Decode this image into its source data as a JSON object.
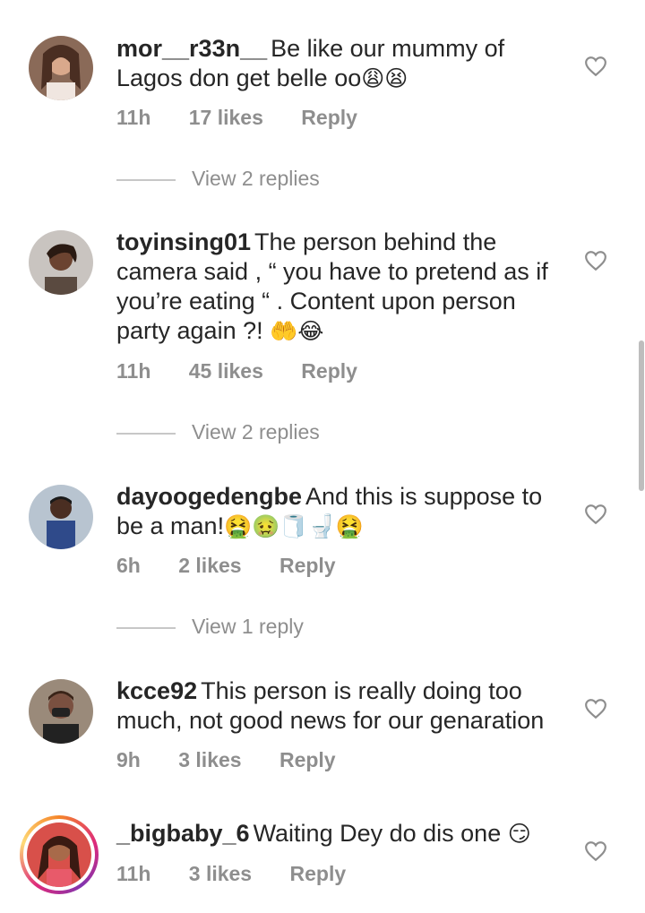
{
  "comments": [
    {
      "username": "mor__r33n__",
      "text": "Be like our mummy of Lagos don get belle oo",
      "emoji": "😩😫",
      "time": "11h",
      "likes": "17 likes",
      "reply": "Reply",
      "view_replies": "View 2 replies"
    },
    {
      "username": "toyinsing01",
      "text": "The person behind the camera said , “ you have to pretend as if you’re eating “ .  Content upon person party again ?!",
      "emoji": "🤲😂",
      "time": "11h",
      "likes": "45 likes",
      "reply": "Reply",
      "view_replies": "View 2 replies"
    },
    {
      "username": "dayoogedengbe",
      "text": "And this is suppose to be a man!",
      "emoji": "🤮🤢🧻🚽🤮",
      "time": "6h",
      "likes": "2 likes",
      "reply": "Reply",
      "view_replies": "View 1 reply"
    },
    {
      "username": "kcce92",
      "text": "This person is really doing too much, not good news for our genaration",
      "emoji": "",
      "time": "9h",
      "likes": "3 likes",
      "reply": "Reply"
    },
    {
      "username": "_bigbaby_6",
      "text": "Waiting Dey do dis one",
      "emoji": "😏",
      "time": "11h",
      "likes": "3 likes",
      "reply": "Reply"
    }
  ],
  "icons": {
    "like": "heart-outline-icon"
  },
  "colors": {
    "text": "#262626",
    "secondary": "#8e8e8e",
    "divider": "#c7c7c7"
  }
}
